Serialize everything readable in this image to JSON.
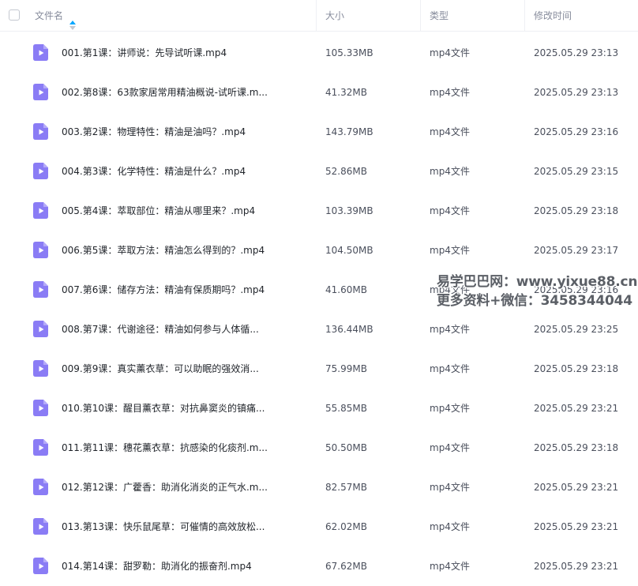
{
  "header": {
    "name_label": "文件名",
    "size_label": "大小",
    "type_label": "类型",
    "modified_label": "修改时间"
  },
  "files": [
    {
      "name": "001.第1课：讲师说：先导试听课.mp4",
      "size": "105.33MB",
      "type": "mp4文件",
      "modified": "2025.05.29 23:13"
    },
    {
      "name": "002.第8课：63款家居常用精油概说-试听课.m...",
      "size": "41.32MB",
      "type": "mp4文件",
      "modified": "2025.05.29 23:13"
    },
    {
      "name": "003.第2课：物理特性：精油是油吗？.mp4",
      "size": "143.79MB",
      "type": "mp4文件",
      "modified": "2025.05.29 23:16"
    },
    {
      "name": "004.第3课：化学特性：精油是什么？.mp4",
      "size": "52.86MB",
      "type": "mp4文件",
      "modified": "2025.05.29 23:15"
    },
    {
      "name": "005.第4课：萃取部位：精油从哪里来？.mp4",
      "size": "103.39MB",
      "type": "mp4文件",
      "modified": "2025.05.29 23:18"
    },
    {
      "name": "006.第5课：萃取方法：精油怎么得到的？.mp4",
      "size": "104.50MB",
      "type": "mp4文件",
      "modified": "2025.05.29 23:17"
    },
    {
      "name": "007.第6课：储存方法：精油有保质期吗？.mp4",
      "size": "41.60MB",
      "type": "mp4文件",
      "modified": "2025.05.29 23:16"
    },
    {
      "name": "008.第7课：代谢途径：精油如何参与人体循...",
      "size": "136.44MB",
      "type": "mp4文件",
      "modified": "2025.05.29 23:25"
    },
    {
      "name": "009.第9课：真实薰衣草：可以助眠的强效消...",
      "size": "75.99MB",
      "type": "mp4文件",
      "modified": "2025.05.29 23:18"
    },
    {
      "name": "010.第10课：醒目薰衣草：对抗鼻窦炎的镇痛...",
      "size": "55.85MB",
      "type": "mp4文件",
      "modified": "2025.05.29 23:21"
    },
    {
      "name": "011.第11课：穗花薰衣草：抗感染的化痰剂.m...",
      "size": "50.50MB",
      "type": "mp4文件",
      "modified": "2025.05.29 23:18"
    },
    {
      "name": "012.第12课：广藿香：助消化消炎的正气水.m...",
      "size": "82.57MB",
      "type": "mp4文件",
      "modified": "2025.05.29 23:21"
    },
    {
      "name": "013.第13课：快乐鼠尾草：可催情的高效放松...",
      "size": "62.02MB",
      "type": "mp4文件",
      "modified": "2025.05.29 23:21"
    },
    {
      "name": "014.第14课：甜罗勒：助消化的振奋剂.mp4",
      "size": "67.62MB",
      "type": "mp4文件",
      "modified": "2025.05.29 23:21"
    }
  ],
  "watermark": {
    "line1": "易学巴巴网：www.yixue88.cn",
    "line2": "更多资料+微信：3458344044"
  },
  "icons": {
    "file_icon": "video-file-icon",
    "sort_icon": "sort-arrows-icon",
    "file_icon_color": "#8a7cf5",
    "sort_up_color": "#06a7ff",
    "sort_down_color": "#c4c8d0"
  }
}
